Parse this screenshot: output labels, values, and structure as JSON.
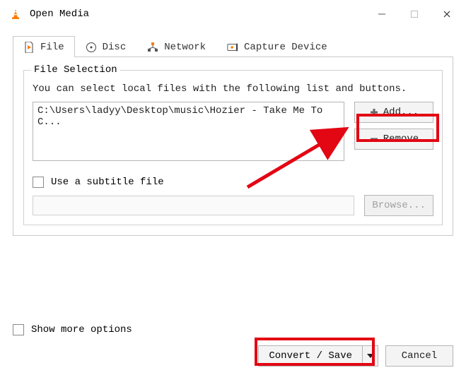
{
  "window": {
    "title": "Open Media",
    "minimize": "Minimize",
    "maximize": "Maximize",
    "close": "Close"
  },
  "tabs": {
    "file": "File",
    "disc": "Disc",
    "network": "Network",
    "capture": "Capture Device"
  },
  "file_section": {
    "legend": "File Selection",
    "help": "You can select local files with the following list and buttons.",
    "entries": [
      "C:\\Users\\ladyy\\Desktop\\music\\Hozier - Take Me To C..."
    ],
    "add_label": "Add...",
    "remove_label": "Remove"
  },
  "subtitle": {
    "checkbox_label": "Use a subtitle file",
    "browse_label": "Browse..."
  },
  "footer": {
    "show_more_label": "Show more options",
    "convert_label": "Convert / Save",
    "cancel_label": "Cancel"
  }
}
